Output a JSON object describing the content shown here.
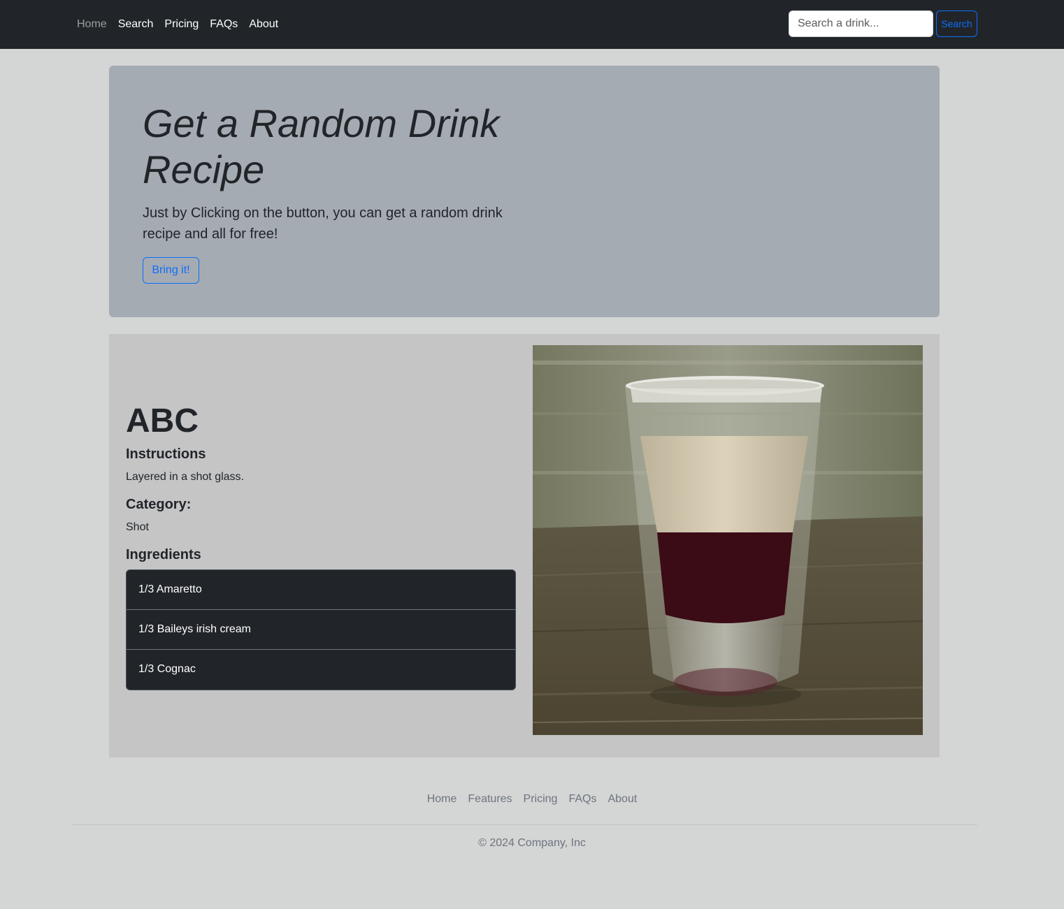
{
  "navbar": {
    "links": [
      "Home",
      "Search",
      "Pricing",
      "FAQs",
      "About"
    ],
    "search_placeholder": "Search a drink...",
    "search_button": "Search"
  },
  "hero": {
    "title": "Get a Random Drink Recipe",
    "lead": "Just by Clicking on the button, you can get a random drink recipe and all for free!",
    "button": "Bring it!"
  },
  "drink": {
    "name": "ABC",
    "instructions_heading": "Instructions",
    "instructions": "Layered in a shot glass.",
    "category_heading": "Category:",
    "category": "Shot",
    "ingredients_heading": "Ingredients",
    "ingredients": [
      "1/3 Amaretto",
      "1/3 Baileys irish cream",
      "1/3 Cognac"
    ]
  },
  "footer": {
    "links": [
      "Home",
      "Features",
      "Pricing",
      "FAQs",
      "About"
    ],
    "copyright": "© 2024 Company, Inc"
  },
  "colors": {
    "navbar_bg": "#212529",
    "page_bg": "#d4d5d5",
    "hero_bg": "#a5abb2",
    "card_bg": "#c5c5c6",
    "accent": "#0d6efd"
  }
}
